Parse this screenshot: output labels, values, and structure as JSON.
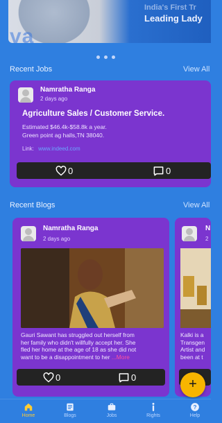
{
  "banner": {
    "watermark": "va",
    "caption_line1": "India's First Tr",
    "caption_line2": "Leading Lady"
  },
  "carousel": {
    "dots": 3
  },
  "recent_jobs": {
    "title": "Recent Jobs",
    "view_all": "View All",
    "card": {
      "author": "Namratha Ranga",
      "posted": "2 days ago",
      "job_title": "Agriculture Sales / Customer Service.",
      "salary": "Estimated $46.4k-$58.8k a year.",
      "location": "Green point ag halls,TN 38040.",
      "link_label": "Link:",
      "link_url": "www.indeed.com",
      "likes": "0",
      "comments": "0"
    }
  },
  "recent_blogs": {
    "title": "Recent Blogs",
    "view_all": "View All",
    "cards": [
      {
        "author": "Namratha Ranga",
        "posted": "2 days ago",
        "text_line1": "Gauri Sawant has struggled out herself from",
        "text_line2": "her family who didn't willfully accept her. She",
        "text_line3": "fled her home at the age of 18 as she did not",
        "text_line4": "want to be a disappointment to her",
        "more_label": "...More",
        "likes": "0",
        "comments": "0"
      },
      {
        "author": "N",
        "posted": "2",
        "text_line1": "Kalki is a",
        "text_line2": "Transgen",
        "text_line3": "Artist and",
        "text_line4": "been at t"
      }
    ]
  },
  "fab": {
    "label": "+"
  },
  "bottom_nav": {
    "items": [
      {
        "label": "Home",
        "icon": "home-icon"
      },
      {
        "label": "Blogs",
        "icon": "blogs-icon"
      },
      {
        "label": "Jobs",
        "icon": "jobs-icon"
      },
      {
        "label": "Rights",
        "icon": "rights-icon"
      },
      {
        "label": "Help",
        "icon": "help-icon"
      }
    ]
  },
  "colors": {
    "background": "#2f7fe0",
    "card": "#7b35cf",
    "action_bar": "#232323",
    "fab": "#f7b500",
    "more_link": "#ff4fa0"
  }
}
